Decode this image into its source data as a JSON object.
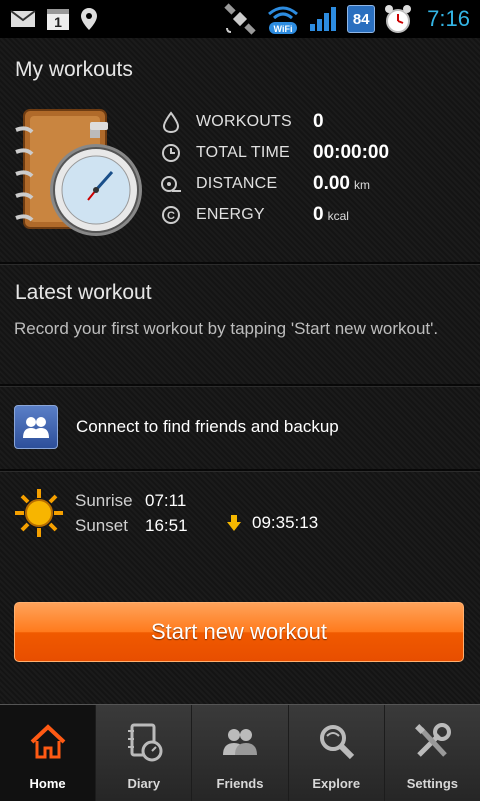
{
  "status_bar": {
    "icons_left": [
      "gmail-icon",
      "calendar-icon",
      "location-icon"
    ],
    "calendar_day": "1",
    "icons_right": [
      "satellite-icon",
      "wifi-icon",
      "signal-icon",
      "battery-icon",
      "alarm-icon"
    ],
    "wifi_label": "WiFi",
    "battery": "84",
    "time": "7:16"
  },
  "my_workouts": {
    "title": "My workouts",
    "stats": [
      {
        "icon": "drop-icon",
        "label": "WORKOUTS",
        "value": "0",
        "unit": ""
      },
      {
        "icon": "clock-icon",
        "label": "TOTAL TIME",
        "value": "00:00:00",
        "unit": ""
      },
      {
        "icon": "distance-icon",
        "label": "DISTANCE",
        "value": "0.00",
        "unit": "km"
      },
      {
        "icon": "energy-icon",
        "label": "ENERGY",
        "value": "0",
        "unit": "kcal"
      }
    ]
  },
  "latest_workout": {
    "title": "Latest workout",
    "description": "Record your first workout by tapping 'Start new workout'."
  },
  "connect": {
    "label": "Connect to find friends and backup"
  },
  "sun": {
    "sunrise_label": "Sunrise",
    "sunrise_time": "07:11",
    "sunset_label": "Sunset",
    "sunset_time": "16:51",
    "day_length": "09:35:13"
  },
  "start_button": {
    "label": "Start new workout"
  },
  "bottom_nav": {
    "items": [
      {
        "label": "Home",
        "icon": "home-icon",
        "active": true
      },
      {
        "label": "Diary",
        "icon": "diary-icon",
        "active": false
      },
      {
        "label": "Friends",
        "icon": "friends-icon",
        "active": false
      },
      {
        "label": "Explore",
        "icon": "explore-icon",
        "active": false
      },
      {
        "label": "Settings",
        "icon": "settings-icon",
        "active": false
      }
    ]
  },
  "colors": {
    "accent": "#ff7a1c",
    "clock": "#33b5e5",
    "home_active": "#ff5a14"
  }
}
